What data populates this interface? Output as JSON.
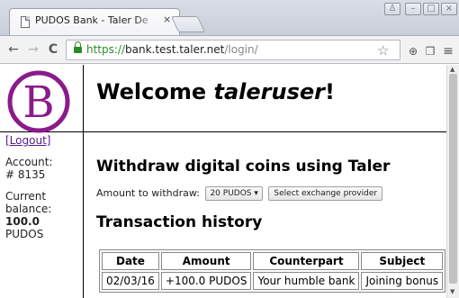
{
  "browser": {
    "tab_title": "PUDOS Bank - Taler De",
    "tab_close": "×",
    "url_scheme": "https://",
    "url_host": "bank.test.taler.net",
    "url_path": "/login/",
    "icons": {
      "back": "←",
      "forward": "→",
      "reload": "C",
      "star": "☆",
      "ext1": "⊕",
      "ext2": "❐",
      "menu": "≡",
      "profile": "♙",
      "minimize": "–",
      "maximize": "□",
      "close": "×"
    }
  },
  "header": {
    "welcome_prefix": "Welcome ",
    "username": "taleruser",
    "welcome_suffix": "!",
    "logo_letter": "B",
    "logo_color": "#8b1a8b"
  },
  "sidebar": {
    "logout": "[Logout]",
    "account_label": "Account:",
    "account_number": "# 8135",
    "balance_label_1": "Current",
    "balance_label_2": "balance:",
    "balance_amount": "100.0",
    "balance_currency": "PUDOS"
  },
  "main": {
    "withdraw_heading": "Withdraw digital coins using Taler",
    "amount_label": "Amount to withdraw:",
    "amount_selected": "20 PUDOS",
    "exchange_button": "Select exchange provider",
    "history_heading": "Transaction history"
  },
  "transactions": {
    "headers": [
      "Date",
      "Amount",
      "Counterpart",
      "Subject"
    ],
    "rows": [
      [
        "02/03/16",
        "+100.0 PUDOS",
        "Your humble bank",
        "Joining bonus"
      ]
    ]
  }
}
